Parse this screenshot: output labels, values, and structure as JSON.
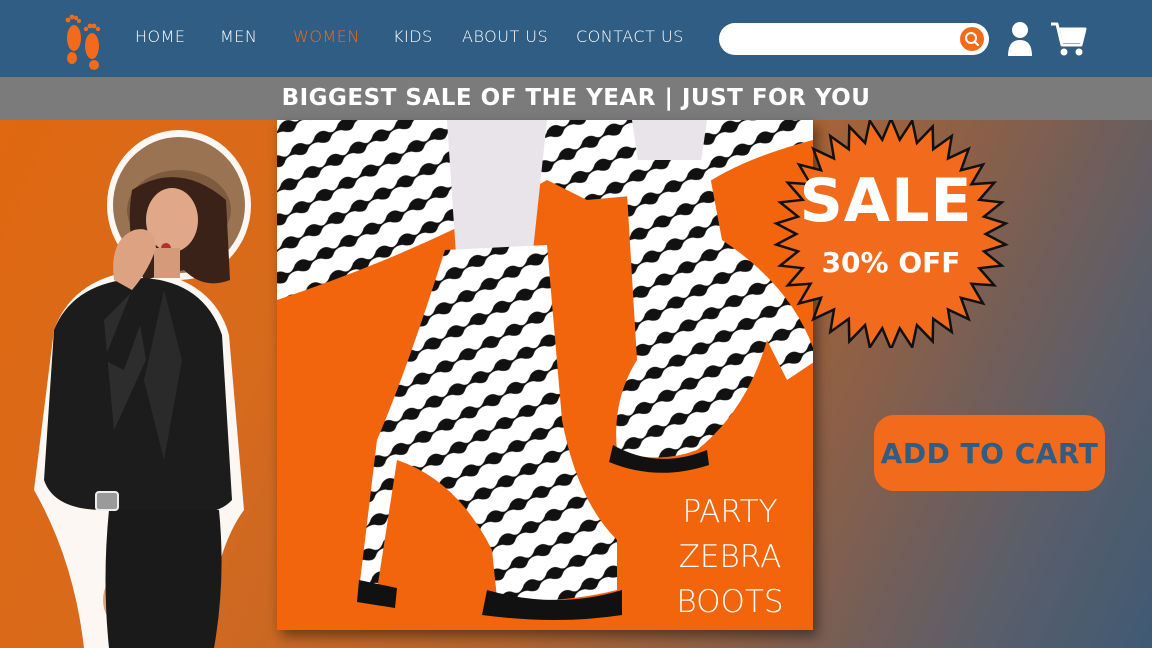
{
  "nav": {
    "items": [
      {
        "label": "HOME",
        "active": false
      },
      {
        "label": "MEN",
        "active": false
      },
      {
        "label": "WOMEN",
        "active": true
      },
      {
        "label": "KIDS",
        "active": false
      },
      {
        "label": "ABOUT US",
        "active": false
      },
      {
        "label": "CONTACT US",
        "active": false
      }
    ],
    "search": {
      "placeholder": "",
      "value": ""
    },
    "icons": {
      "logo": "footprints-icon",
      "search": "search-icon",
      "user": "user-icon",
      "cart": "cart-icon"
    }
  },
  "banner": {
    "text": "BIGGEST SALE OF THE YEAR | JUST FOR YOU"
  },
  "product": {
    "title_lines": [
      "PARTY",
      "ZEBRA",
      "BOOTS"
    ],
    "image": "zebra-print-platform-boots"
  },
  "sale": {
    "label": "SALE",
    "discount": "30% OFF"
  },
  "cta": {
    "add_to_cart": "ADD TO CART"
  },
  "colors": {
    "nav_bg": "#2f5d84",
    "accent": "#f26a1b",
    "banner_bg": "#7b7b7b",
    "cta_text": "#2f5d84"
  }
}
